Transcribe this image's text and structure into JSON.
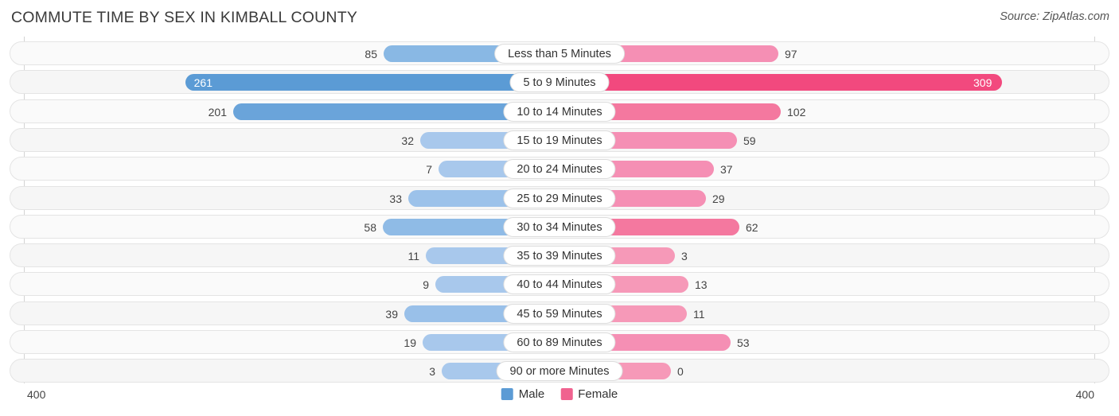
{
  "header": {
    "title": "COMMUTE TIME BY SEX IN KIMBALL COUNTY",
    "source": "Source: ZipAtlas.com"
  },
  "footer": {
    "axis_max_left": "400",
    "axis_max_right": "400",
    "legend": [
      {
        "label": "Male",
        "color": "#5B9BD5"
      },
      {
        "label": "Female",
        "color": "#F0628F"
      }
    ]
  },
  "colors": {
    "male_strong": "#5B9BD5",
    "male_light": "#A8C8EC",
    "female_strong": "#F4689B",
    "female_light": "#F699B8",
    "female_bright": "#F2497E",
    "track": "#FAFAFA",
    "track_border": "#E4E4E4",
    "axis": "#D3D3D3"
  },
  "chart_data": {
    "type": "bar",
    "subtype": "diverging-horizontal",
    "title": "COMMUTE TIME BY SEX IN KIMBALL COUNTY",
    "xlabel": "",
    "ylabel": "",
    "xlim": [
      400,
      400
    ],
    "grid": false,
    "legend_position": "bottom-center",
    "categories": [
      "Less than 5 Minutes",
      "5 to 9 Minutes",
      "10 to 14 Minutes",
      "15 to 19 Minutes",
      "20 to 24 Minutes",
      "25 to 29 Minutes",
      "30 to 34 Minutes",
      "35 to 39 Minutes",
      "40 to 44 Minutes",
      "45 to 59 Minutes",
      "60 to 89 Minutes",
      "90 or more Minutes"
    ],
    "series": [
      {
        "name": "Male",
        "values": [
          85,
          261,
          201,
          32,
          7,
          33,
          58,
          11,
          9,
          39,
          19,
          3
        ]
      },
      {
        "name": "Female",
        "values": [
          97,
          309,
          102,
          59,
          37,
          29,
          62,
          3,
          13,
          11,
          53,
          0
        ]
      }
    ]
  },
  "rows": [
    {
      "category": "Less than 5 Minutes",
      "male": "85",
      "female": "97",
      "male_w": 221,
      "female_w": 275,
      "male_color": "#89B8E4",
      "female_color": "#F58FB4",
      "male_inside": false,
      "female_inside": false
    },
    {
      "category": "5 to 9 Minutes",
      "male": "261",
      "female": "309",
      "male_w": 470,
      "female_w": 556,
      "male_color": "#5B9BD5",
      "female_color": "#F2497E",
      "male_inside": true,
      "female_inside": true
    },
    {
      "category": "10 to 14 Minutes",
      "male": "201",
      "female": "102",
      "male_w": 410,
      "female_w": 278,
      "male_color": "#6AA4DA",
      "female_color": "#F4789F",
      "male_inside": false,
      "female_inside": false
    },
    {
      "category": "15 to 19 Minutes",
      "male": "32",
      "female": "59",
      "male_w": 175,
      "female_w": 223,
      "male_color": "#A8C8EC",
      "female_color": "#F58FB4",
      "male_inside": false,
      "female_inside": false
    },
    {
      "category": "20 to 24 Minutes",
      "male": "7",
      "female": "37",
      "male_w": 152,
      "female_w": 194,
      "male_color": "#A8C8EC",
      "female_color": "#F58FB4",
      "male_inside": false,
      "female_inside": false
    },
    {
      "category": "25 to 29 Minutes",
      "male": "33",
      "female": "29",
      "male_w": 190,
      "female_w": 184,
      "male_color": "#9CC2EA",
      "female_color": "#F58FB4",
      "male_inside": false,
      "female_inside": false
    },
    {
      "category": "30 to 34 Minutes",
      "male": "58",
      "female": "62",
      "male_w": 222,
      "female_w": 226,
      "male_color": "#8FBBE6",
      "female_color": "#F4789F",
      "male_inside": false,
      "female_inside": false
    },
    {
      "category": "35 to 39 Minutes",
      "male": "11",
      "female": "3",
      "male_w": 168,
      "female_w": 145,
      "male_color": "#A8C8EC",
      "female_color": "#F699B8",
      "male_inside": false,
      "female_inside": false
    },
    {
      "category": "40 to 44 Minutes",
      "male": "9",
      "female": "13",
      "male_w": 156,
      "female_w": 162,
      "male_color": "#A8C8EC",
      "female_color": "#F699B8",
      "male_inside": false,
      "female_inside": false
    },
    {
      "category": "45 to 59 Minutes",
      "male": "39",
      "female": "11",
      "male_w": 195,
      "female_w": 160,
      "male_color": "#99C0E9",
      "female_color": "#F699B8",
      "male_inside": false,
      "female_inside": false
    },
    {
      "category": "60 to 89 Minutes",
      "male": "19",
      "female": "53",
      "male_w": 172,
      "female_w": 215,
      "male_color": "#A8C8EC",
      "female_color": "#F58FB4",
      "male_inside": false,
      "female_inside": false
    },
    {
      "category": "90 or more Minutes",
      "male": "3",
      "female": "0",
      "male_w": 148,
      "female_w": 140,
      "male_color": "#A8C8EC",
      "female_color": "#F699B8",
      "male_inside": false,
      "female_inside": false
    }
  ]
}
